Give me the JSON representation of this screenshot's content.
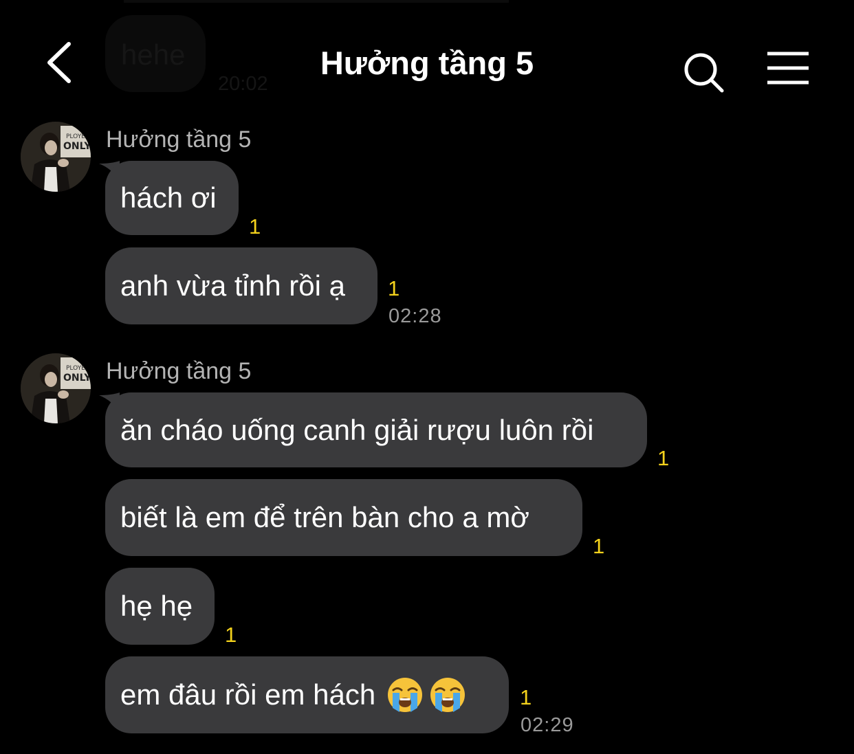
{
  "header": {
    "title": "Hưởng tầng 5"
  },
  "previous": {
    "text": "hehe",
    "time": "20:02"
  },
  "groups": [
    {
      "sender": "Hưởng tầng 5",
      "messages": [
        {
          "text": "hách ơi",
          "unread": "1"
        },
        {
          "text": "anh vừa tỉnh rồi ạ",
          "unread": "1"
        }
      ],
      "time": "02:28"
    },
    {
      "sender": "Hưởng tầng 5",
      "messages": [
        {
          "text": "ăn cháo uống canh giải rượu luôn rồi",
          "unread": "1"
        },
        {
          "text": "biết là em để trên bàn cho a mờ",
          "unread": "1"
        },
        {
          "text": "hẹ hẹ",
          "unread": "1"
        },
        {
          "text": "em đâu rồi em hách",
          "emoji": [
            "loudly-crying-face",
            "loudly-crying-face"
          ],
          "unread": "1"
        }
      ],
      "time": "02:29"
    }
  ],
  "avatar_badge_text": "ONLY",
  "colors": {
    "background": "#000000",
    "bubble": "#3a3a3c",
    "unread": "#f4d21c",
    "timestamp": "#9a9a9a"
  }
}
